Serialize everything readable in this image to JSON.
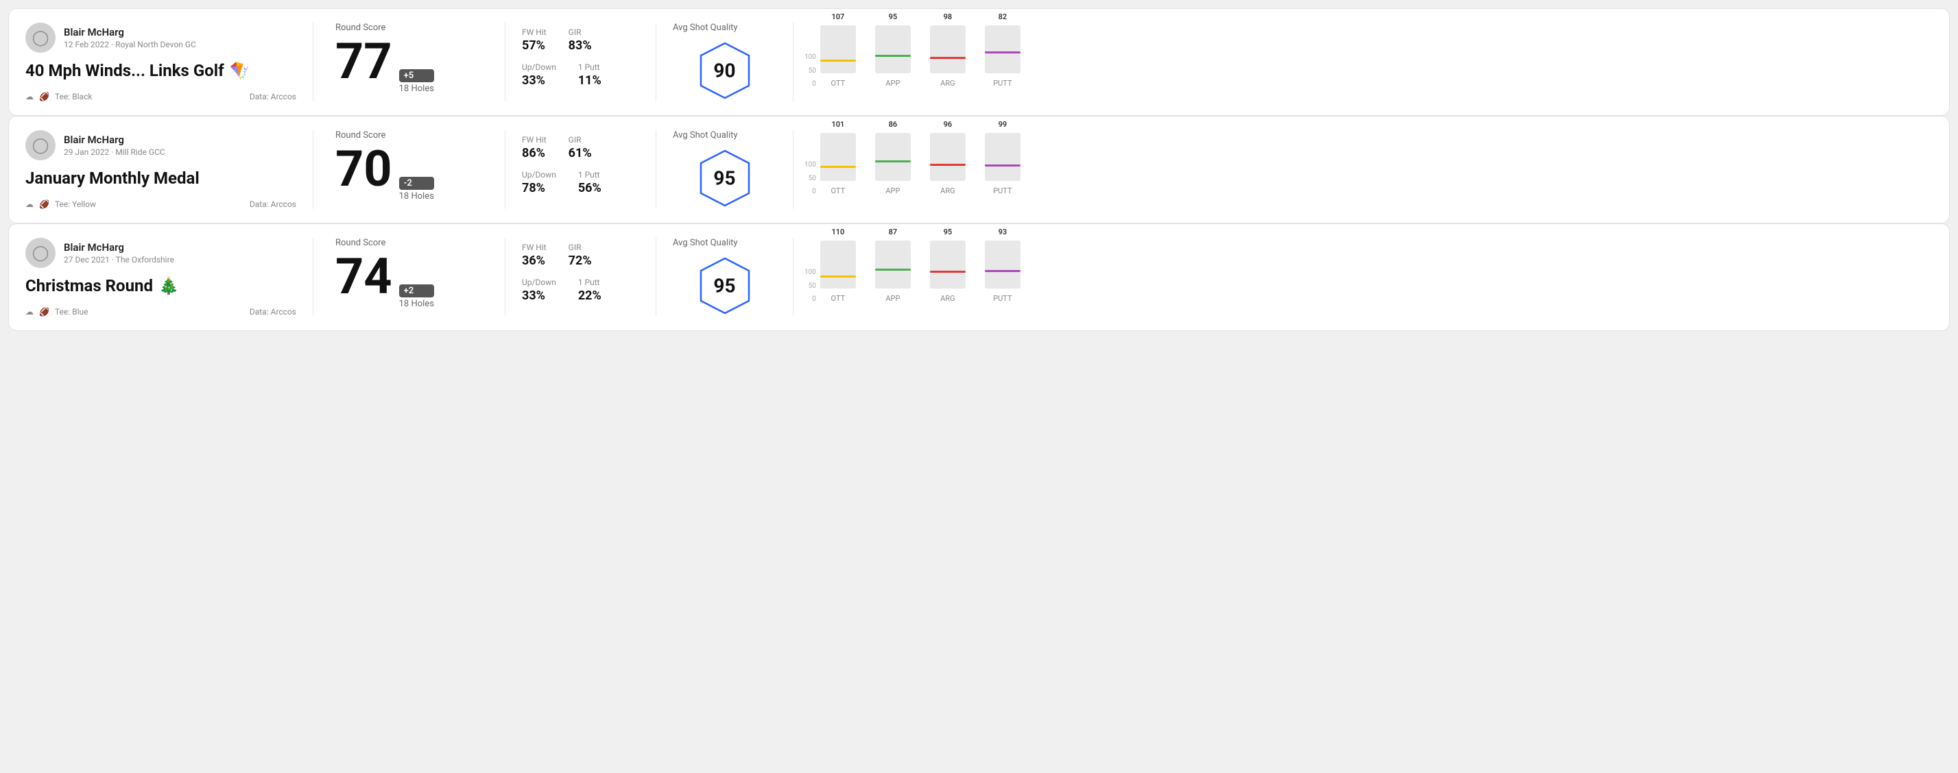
{
  "rounds": [
    {
      "id": "round1",
      "player_name": "Blair McHarg",
      "date": "12 Feb 2022 · Royal North Devon GC",
      "title": "40 Mph Winds... Links Golf",
      "title_emoji": "🪁",
      "tee": "Tee: Black",
      "data_source": "Data: Arccos",
      "score": "77",
      "score_diff": "+5",
      "holes": "18 Holes",
      "fw_hit": "57%",
      "gir": "83%",
      "up_down": "33%",
      "one_putt": "11%",
      "avg_quality": "90",
      "avg_quality_label": "Avg Shot Quality",
      "chart": {
        "bars": [
          {
            "label": "OTT",
            "value": 107,
            "color": "#f5c000",
            "pct": 72
          },
          {
            "label": "APP",
            "value": 95,
            "color": "#4caf50",
            "pct": 62
          },
          {
            "label": "ARG",
            "value": 98,
            "color": "#e53935",
            "pct": 65
          },
          {
            "label": "PUTT",
            "value": 82,
            "color": "#ab47bc",
            "pct": 54
          }
        ]
      }
    },
    {
      "id": "round2",
      "player_name": "Blair McHarg",
      "date": "29 Jan 2022 · Mill Ride GCC",
      "title": "January Monthly Medal",
      "title_emoji": "",
      "tee": "Tee: Yellow",
      "data_source": "Data: Arccos",
      "score": "70",
      "score_diff": "-2",
      "holes": "18 Holes",
      "fw_hit": "86%",
      "gir": "61%",
      "up_down": "78%",
      "one_putt": "56%",
      "avg_quality": "95",
      "avg_quality_label": "Avg Shot Quality",
      "chart": {
        "bars": [
          {
            "label": "OTT",
            "value": 101,
            "color": "#f5c000",
            "pct": 68
          },
          {
            "label": "APP",
            "value": 86,
            "color": "#4caf50",
            "pct": 57
          },
          {
            "label": "ARG",
            "value": 96,
            "color": "#e53935",
            "pct": 64
          },
          {
            "label": "PUTT",
            "value": 99,
            "color": "#ab47bc",
            "pct": 66
          }
        ]
      }
    },
    {
      "id": "round3",
      "player_name": "Blair McHarg",
      "date": "27 Dec 2021 · The Oxfordshire",
      "title": "Christmas Round",
      "title_emoji": "🎄",
      "tee": "Tee: Blue",
      "data_source": "Data: Arccos",
      "score": "74",
      "score_diff": "+2",
      "holes": "18 Holes",
      "fw_hit": "36%",
      "gir": "72%",
      "up_down": "33%",
      "one_putt": "22%",
      "avg_quality": "95",
      "avg_quality_label": "Avg Shot Quality",
      "chart": {
        "bars": [
          {
            "label": "OTT",
            "value": 110,
            "color": "#f5c000",
            "pct": 73
          },
          {
            "label": "APP",
            "value": 87,
            "color": "#4caf50",
            "pct": 58
          },
          {
            "label": "ARG",
            "value": 95,
            "color": "#e53935",
            "pct": 63
          },
          {
            "label": "PUTT",
            "value": 93,
            "color": "#ab47bc",
            "pct": 62
          }
        ]
      }
    }
  ],
  "labels": {
    "round_score": "Round Score",
    "fw_hit": "FW Hit",
    "gir": "GIR",
    "up_down": "Up/Down",
    "one_putt": "1 Putt",
    "avg_quality": "Avg Shot Quality"
  }
}
